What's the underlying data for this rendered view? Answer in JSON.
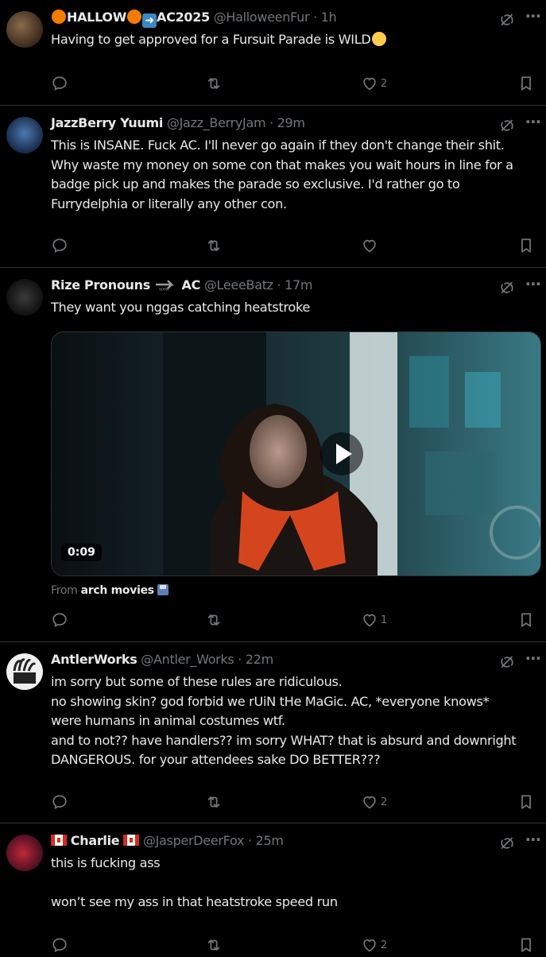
{
  "posts": [
    {
      "name": "HALLOW AC2025",
      "name_parts": [
        "HALLOW",
        "AC2025"
      ],
      "handle": "@HalloweenFur",
      "time": "1h",
      "lines": [
        "Having to get approved for a Fursuit Parade is WILD"
      ],
      "likes": "2"
    },
    {
      "name": "JazzBerry Yuumi",
      "handle": "@Jazz_BerryJam",
      "time": "29m",
      "lines": [
        "This is INSANE. Fuck AC. I'll never go again if they don't change their shit.",
        "Why waste my money on some con that makes you wait hours in line for a",
        "badge pick up and makes the parade so exclusive. I'd rather go to",
        "Furrydelphia or literally any other con."
      ],
      "likes": ""
    },
    {
      "name": "Rize Pronouns",
      "name_suffix": "AC",
      "handle": "@LeeeBatz",
      "time": "17m",
      "lines": [
        "They want you nggas catching heatstroke"
      ],
      "video_duration": "0:09",
      "from_label": "From",
      "from_source": "arch movies",
      "likes": "1"
    },
    {
      "name": "AntlerWorks",
      "handle": "@Antler_Works",
      "time": "22m",
      "lines": [
        "im sorry but some of these rules are ridiculous.",
        "no showing skin? god forbid we rUiN tHe MaGic. AC, *everyone knows*",
        "were humans in animal costumes wtf.",
        "and to not?? have handlers?? im sorry WHAT? that is absurd and downright",
        "DANGEROUS. for your attendees sake DO BETTER???"
      ],
      "likes": "2"
    },
    {
      "name": "Charlie",
      "handle": "@JasperDeerFox",
      "time": "25m",
      "lines": [
        "this is fucking ass",
        "",
        "won’t see my ass in that heatstroke speed run"
      ],
      "likes": "2"
    }
  ],
  "separator": "·"
}
